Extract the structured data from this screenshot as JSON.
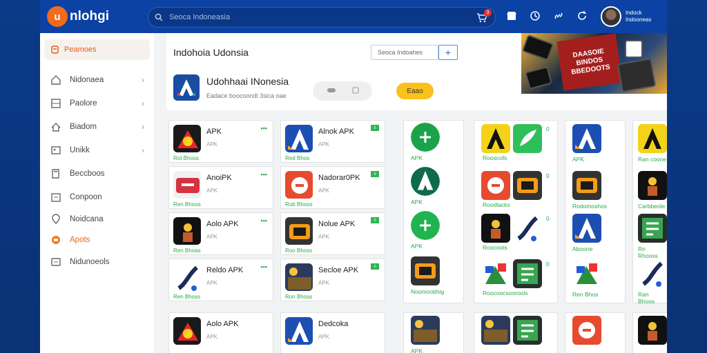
{
  "brand": {
    "logo_mark": "u",
    "name": "nlohgi"
  },
  "search": {
    "placeholder": "Seoca Indoneasia"
  },
  "cart": {
    "badge": "3"
  },
  "user": {
    "line1": "Indock",
    "line2": "Indooneas"
  },
  "sidebar": {
    "header": "Peamoes",
    "items": [
      {
        "label": "Nidonaea",
        "icon": "home-icon",
        "chevron": true
      },
      {
        "label": "Paolore",
        "icon": "grid-icon",
        "chevron": true
      },
      {
        "label": "Biadom",
        "icon": "house-icon",
        "chevron": true
      },
      {
        "label": "Unikk",
        "icon": "image-icon",
        "chevron": true
      },
      {
        "label": "Beccboos",
        "icon": "book-icon",
        "chevron": false
      },
      {
        "label": "Conpoon",
        "icon": "calendar-icon",
        "chevron": false
      },
      {
        "label": "Noidcana",
        "icon": "location-icon",
        "chevron": false
      },
      {
        "label": "Apots",
        "icon": "apps-icon",
        "chevron": false,
        "active": true
      },
      {
        "label": "Nidunoeols",
        "icon": "list-icon",
        "chevron": false
      }
    ]
  },
  "hero": {
    "title": "Indohoia Udonsia",
    "input": "Seoca Indoahes",
    "plus": "+",
    "app_name": "Udohhaai INonesia",
    "app_sub": "Eadace boocoondl 3sica oae",
    "button": "Eaao"
  },
  "banner": {
    "text": "DAASOIE BINDOS BBEDOOTS"
  },
  "col1": [
    {
      "name": "APK",
      "sub": "APK",
      "dev": "Rot Bhoss"
    },
    {
      "name": "AnoiPK",
      "sub": "APK",
      "dev": "Ren Bhoos"
    },
    {
      "name": "Aolo APK",
      "sub": "APK",
      "dev": "Ren Bhoas"
    },
    {
      "name": "Reldo APK",
      "sub": "APK",
      "dev": "Ren Bhoss"
    },
    {
      "name": "Aolo APK",
      "sub": "APK",
      "dev": ""
    }
  ],
  "col2": [
    {
      "name": "Alnok APK",
      "sub": "APK",
      "dev": "Red Bhos"
    },
    {
      "name": "Nadorar0PK",
      "sub": "APK",
      "dev": "Rob Bhoos"
    },
    {
      "name": "Nolue APK",
      "sub": "APK",
      "dev": "Roo Bhoss"
    },
    {
      "name": "Secloe APK",
      "sub": "APK",
      "dev": "Ron Bhoss"
    },
    {
      "name": "Dedcoka",
      "sub": "APK",
      "dev": ""
    }
  ],
  "col3": {
    "labels": [
      "APK",
      "APK",
      "APK",
      "Noomoobhig",
      "APK"
    ]
  },
  "col4": {
    "labels": [
      "Rooscofs",
      "Roodlacks",
      "Roocoots",
      "Roocoocsoorools"
    ],
    "nums": [
      "0",
      "0",
      "0",
      "0"
    ]
  },
  "col5": {
    "labels": [
      "APK",
      "Rodomoshos",
      "Aboone",
      "Ren Bhos"
    ]
  },
  "col6": {
    "labels": [
      "Ran coone",
      "Carbbeole",
      "Rn Rhooss",
      "Ran Bhoos"
    ]
  }
}
